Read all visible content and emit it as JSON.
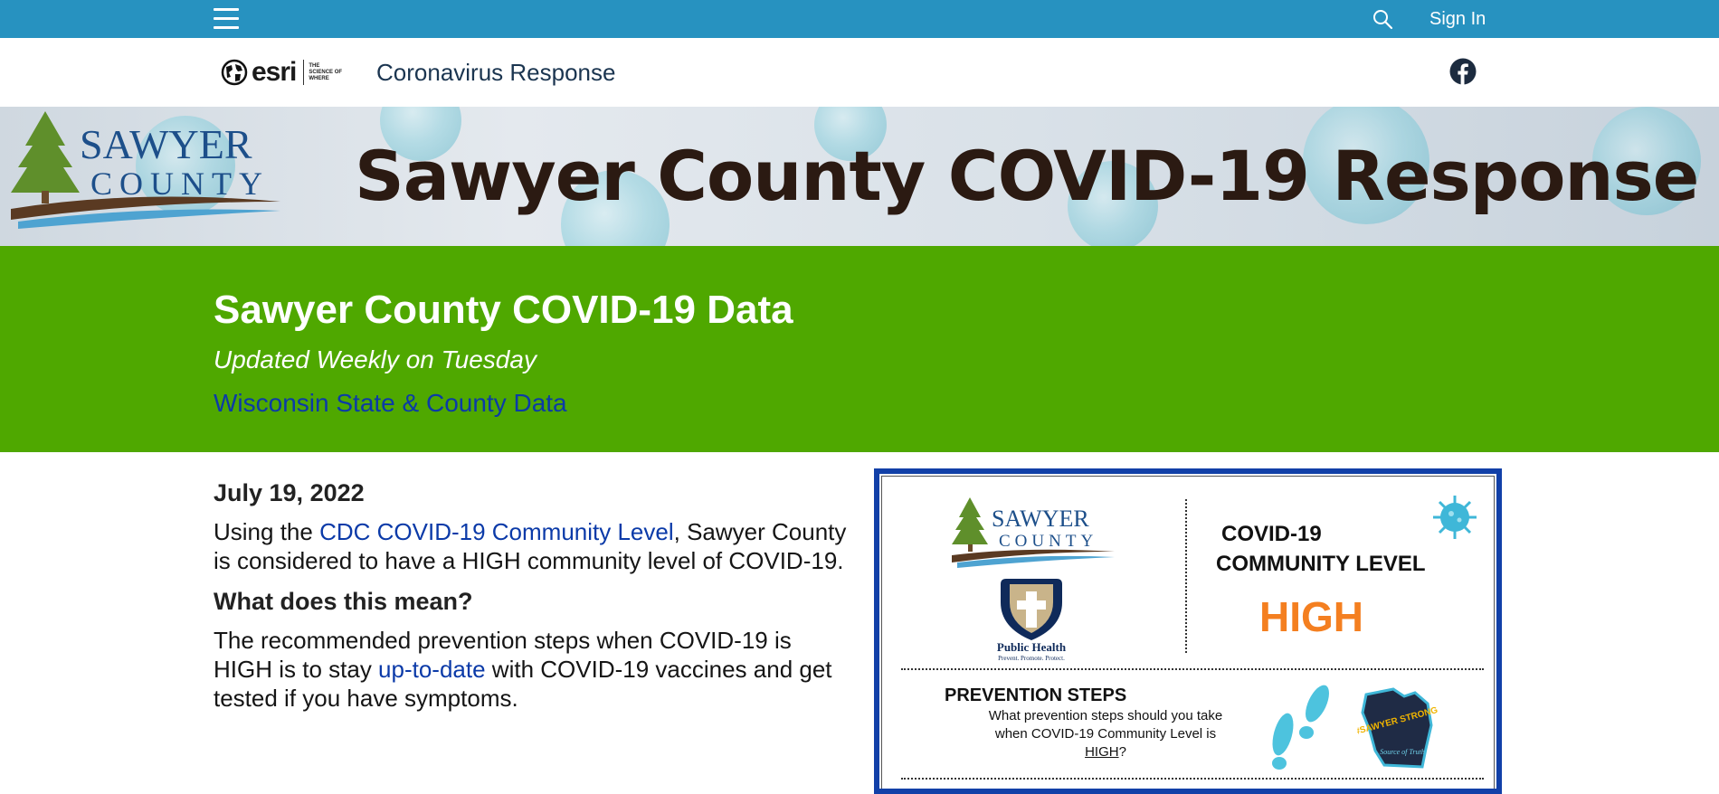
{
  "topbar": {
    "menu_icon": "hamburger-menu-icon",
    "search_icon": "search-icon",
    "signin_label": "Sign In"
  },
  "header": {
    "logo_word": "esri",
    "logo_tagline": "THE SCIENCE OF WHERE",
    "site_title": "Coronavirus Response",
    "facebook_icon": "facebook-icon"
  },
  "banner": {
    "logo_line1": "SAWYER",
    "logo_line2": "COUNTY",
    "title": "Sawyer County COVID-19 Response"
  },
  "data_section": {
    "title": "Sawyer County COVID-19 Data",
    "subtitle": "Updated Weekly on Tuesday",
    "state_link": "Wisconsin State & County Data"
  },
  "article": {
    "date": "July 19, 2022",
    "p1_before": "Using the ",
    "p1_link": "CDC COVID-19 Community Level",
    "p1_after": ", Sawyer County is considered to have a HIGH community level of COVID-19.",
    "question": "What does this mean?",
    "p2_before": "The recommended prevention steps when COVID-19 is HIGH is to stay ",
    "p2_link": "up-to-date",
    "p2_after": " with COVID-19 vaccines and get tested if you have symptoms."
  },
  "infographic": {
    "logo_line1": "SAWYER",
    "logo_line2": "COUNTY",
    "ph_name": "Public Health",
    "ph_tagline": "Prevent. Promote. Protect.",
    "level_title_line1": "COVID-19",
    "level_title_line2": "COMMUNITY LEVEL",
    "level": "HIGH",
    "prevention_title": "PREVENTION STEPS",
    "prevention_q_before": "What prevention steps should you take when COVID-19 Community Level is ",
    "prevention_q_level": "HIGH",
    "prevention_q_after": "?",
    "wi_badge_text": "#SAWYER STRONG",
    "wi_badge_sub": "Source of Truth",
    "colors": {
      "level": "#f47f20",
      "border": "#1240a8"
    }
  },
  "colors": {
    "topbar": "#2792c0",
    "green": "#4fa800",
    "link": "#0b3aa8"
  }
}
